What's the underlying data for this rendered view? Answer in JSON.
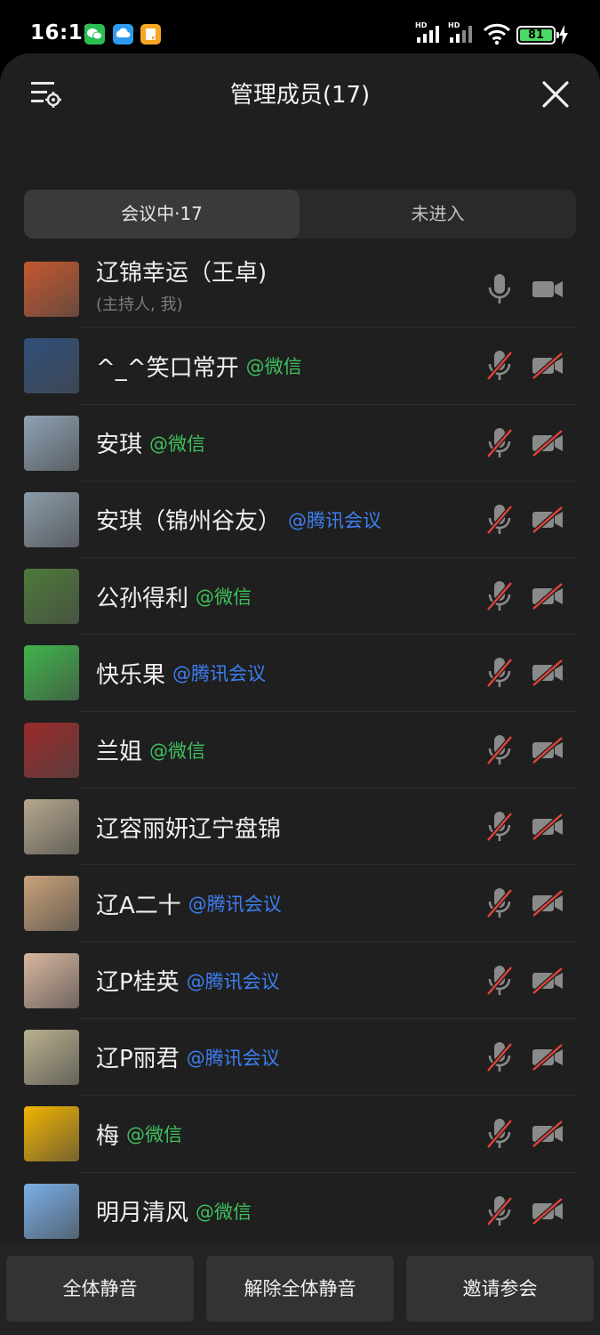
{
  "status_bar": {
    "time": "16:18",
    "apps": [
      {
        "icon": "wechat-icon",
        "color": "#2bbe52"
      },
      {
        "icon": "cloud-app-icon",
        "color": "#2c9bf0"
      },
      {
        "icon": "notes-app-icon",
        "color": "#f5a623"
      }
    ],
    "signal_label_1": "HD",
    "signal_label_2": "HD",
    "battery": "81"
  },
  "header": {
    "title": "管理成员(17)",
    "menu_icon": "list-settings-icon",
    "close_icon": "close-icon"
  },
  "tabs": [
    {
      "label": "会议中·17",
      "active": true
    },
    {
      "label": "未进入",
      "active": false
    }
  ],
  "members": [
    {
      "name": "辽锦幸运（王卓)",
      "tag": "",
      "tag_type": "",
      "subtitle": "(主持人, 我)",
      "muted": false,
      "avatar_color": "#c5582f"
    },
    {
      "name": "^_^笑口常开",
      "tag": "@微信",
      "tag_type": "wx",
      "muted": true,
      "avatar_color": "#2f4f7a"
    },
    {
      "name": "安琪",
      "tag": "@微信",
      "tag_type": "wx",
      "muted": true,
      "avatar_color": "#8fa2b4"
    },
    {
      "name": "安琪（锦州谷友）",
      "tag": "@腾讯会议",
      "tag_type": "tm",
      "muted": true,
      "avatar_color": "#8c9caa"
    },
    {
      "name": "公孙得利",
      "tag": "@微信",
      "tag_type": "wx",
      "muted": true,
      "avatar_color": "#4e7a3a"
    },
    {
      "name": "快乐果",
      "tag": "@腾讯会议",
      "tag_type": "tm",
      "muted": true,
      "avatar_color": "#3fb54a"
    },
    {
      "name": "兰姐",
      "tag": "@微信",
      "tag_type": "wx",
      "muted": true,
      "avatar_color": "#9b2a2a"
    },
    {
      "name": "辽容丽妍辽宁盘锦",
      "tag": "",
      "tag_type": "",
      "muted": true,
      "avatar_color": "#b6a88e"
    },
    {
      "name": "辽A二十",
      "tag": "@腾讯会议",
      "tag_type": "tm",
      "muted": true,
      "avatar_color": "#c9a27a"
    },
    {
      "name": "辽P桂英",
      "tag": "@腾讯会议",
      "tag_type": "tm",
      "muted": true,
      "avatar_color": "#d9b7a0"
    },
    {
      "name": "辽P丽君",
      "tag": "@腾讯会议",
      "tag_type": "tm",
      "muted": true,
      "avatar_color": "#b9b08e"
    },
    {
      "name": "梅",
      "tag": "@微信",
      "tag_type": "wx",
      "muted": true,
      "avatar_color": "#f2b400"
    },
    {
      "name": "明月清风",
      "tag": "@微信",
      "tag_type": "wx",
      "muted": true,
      "avatar_color": "#7ab0e8"
    }
  ],
  "footer": {
    "mute_all": "全体静音",
    "unmute_all": "解除全体静音",
    "invite": "邀请参会"
  },
  "colors": {
    "wechat_tag": "#3ec05c",
    "tencent_tag": "#3d7ff0",
    "muted_slash": "#e0443a"
  }
}
